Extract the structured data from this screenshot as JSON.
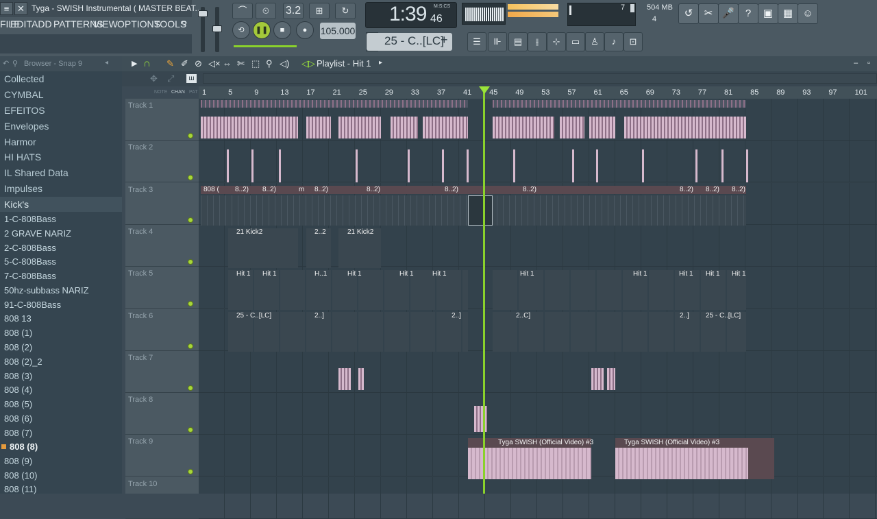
{
  "window": {
    "title": "Tyga - SWISH Instrumental ( MASTER BEAT.."
  },
  "menu": [
    "FILE",
    "EDIT",
    "ADD",
    "PATTERNS",
    "VIEW",
    "OPTIONS",
    "TOOLS",
    "?"
  ],
  "transport": {
    "time": "1:39",
    "time_sub": "46",
    "time_label": "M:S:CS",
    "tempo": "105.000",
    "pattern": "25 - C..[LC]",
    "cpu": "7",
    "mem": "504 MB",
    "voices": "4",
    "snap_value": "3.2"
  },
  "browser": {
    "title": "Browser - Snap 9",
    "items": [
      "Collected",
      "CYMBAL",
      "EFEITOS",
      "Envelopes",
      "Harmor",
      "HI HATS",
      "IL Shared Data",
      "Impulses",
      "Kick's",
      "1-C-808Bass",
      "2 GRAVE NARIZ",
      "2-C-808Bass",
      "5-C-808Bass",
      "7-C-808Bass",
      "50hz-subbass NARIZ",
      "91-C-808Bass",
      "808 13",
      "808 (1)",
      "808 (2)",
      "808 (2)_2",
      "808 (3)",
      "808 (4)",
      "808 (5)",
      "808 (6)",
      "808 (7)",
      "808 (8)",
      "808 (9)",
      "808 (10)",
      "808 (11)"
    ]
  },
  "playlist": {
    "title": "Playlist - Hit 1",
    "col_note": "NOTE",
    "col_chan": "CHAN",
    "col_pat": "PAT",
    "ruler": [
      "1",
      "5",
      "9",
      "13",
      "17",
      "21",
      "25",
      "29",
      "33",
      "37",
      "41",
      "45",
      "49",
      "53",
      "57",
      "61",
      "65",
      "69",
      "73",
      "77",
      "81",
      "85",
      "89",
      "93",
      "97",
      "101"
    ],
    "tracks": [
      "Track 1",
      "Track 2",
      "Track 3",
      "Track 4",
      "Track 5",
      "Track 6",
      "Track 7",
      "Track 8",
      "Track 9",
      "Track 10"
    ],
    "clip_labels": {
      "t3_808": "808 (",
      "t3_short": "8..2)",
      "t3_m": "m",
      "t4_kick": "21 Kick2",
      "t4_short": "2..2",
      "t5_hit": "Hit 1",
      "t5_short": "H..1",
      "t6_c": "25 - C..[LC]",
      "t6_short": "2..]",
      "t6_c2": "2..C]",
      "t9_audio": "Tyga  SWISH (Official Video) #3"
    }
  },
  "colors": {
    "accent": "#9be33a",
    "audio": "#d6b9cd"
  }
}
